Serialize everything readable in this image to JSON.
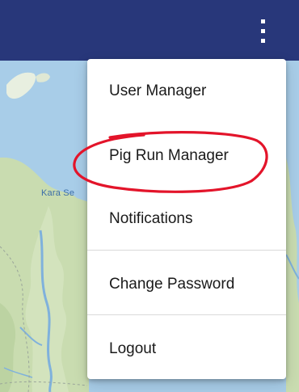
{
  "header": {
    "menu_icon": "more-vert-icon",
    "background_color": "#28377a"
  },
  "map": {
    "sea_label": "Kara Se",
    "water_color": "#a8cde8",
    "land_color": "#c9dcb0"
  },
  "menu": {
    "items": [
      {
        "label": "User Manager"
      },
      {
        "label": "Pig Run Manager"
      },
      {
        "label": "Notifications"
      },
      {
        "label": "Change Password"
      },
      {
        "label": "Logout"
      }
    ]
  },
  "annotation": {
    "shape": "hand-drawn-ellipse",
    "color": "#e3142a"
  }
}
